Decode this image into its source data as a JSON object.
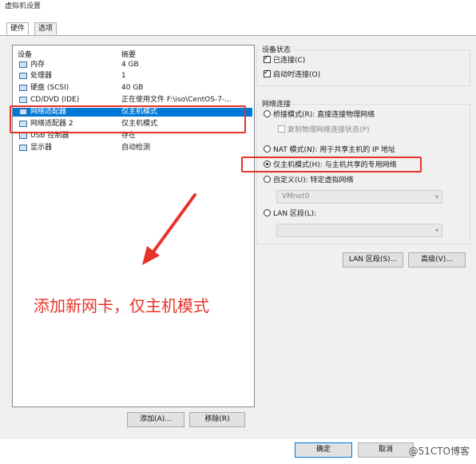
{
  "window": {
    "title": "虚拟机设置"
  },
  "tabs": [
    {
      "label": "硬件"
    },
    {
      "label": "选项"
    }
  ],
  "device_list": {
    "headers": {
      "device": "设备",
      "summary": "摘要"
    },
    "rows": [
      {
        "device": "内存",
        "summary": "4 GB",
        "icon": "memory-icon",
        "selected": false
      },
      {
        "device": "处理器",
        "summary": "1",
        "icon": "processor-icon",
        "selected": false
      },
      {
        "device": "硬盘 (SCSI)",
        "summary": "40 GB",
        "icon": "hard-disk-icon",
        "selected": false
      },
      {
        "device": "CD/DVD (IDE)",
        "summary": "正在使用文件 F:\\iso\\CentOS-7-...",
        "icon": "cd-dvd-icon",
        "selected": false
      },
      {
        "device": "网络适配器",
        "summary": "仅主机模式",
        "icon": "network-adapter-icon",
        "selected": true
      },
      {
        "device": "网络适配器 2",
        "summary": "仅主机模式",
        "icon": "network-adapter-icon",
        "selected": false
      },
      {
        "device": "USB 控制器",
        "summary": "存在",
        "icon": "usb-icon",
        "selected": false
      },
      {
        "device": "显示器",
        "summary": "自动检测",
        "icon": "display-icon",
        "selected": false
      }
    ]
  },
  "buttons": {
    "add": "添加(A)...",
    "remove": "移除(R)",
    "lan_segments": "LAN 区段(S)...",
    "advanced": "高级(V)...",
    "ok": "确定",
    "cancel": "取消"
  },
  "device_status": {
    "title": "设备状态",
    "connected": {
      "label": "已连接(C)",
      "checked": true
    },
    "connect_at_power_on": {
      "label": "启动时连接(O)",
      "checked": true
    }
  },
  "network_connection": {
    "title": "网络连接",
    "bridged": {
      "label": "桥接模式(R): 直接连接物理网络",
      "selected": false
    },
    "replicate": {
      "label": "复制物理网络连接状态(P)",
      "checked": false,
      "enabled": false
    },
    "nat": {
      "label": "NAT 模式(N): 用于共享主机的 IP 地址",
      "selected": false
    },
    "host_only": {
      "label": "仅主机模式(H): 与主机共享的专用网络",
      "selected": true
    },
    "custom": {
      "label": "自定义(U): 特定虚拟网络",
      "selected": false
    },
    "custom_value": "VMnet0",
    "lan_segment": {
      "label": "LAN 区段(L):",
      "selected": false
    },
    "lan_segment_value": ""
  },
  "annotation": {
    "text": "添加新网卡，仅主机模式",
    "color": "#e8332a"
  },
  "watermark": "@51CTO博客",
  "colors": {
    "selection": "#0078d7",
    "highlight_red": "#e8332a"
  }
}
